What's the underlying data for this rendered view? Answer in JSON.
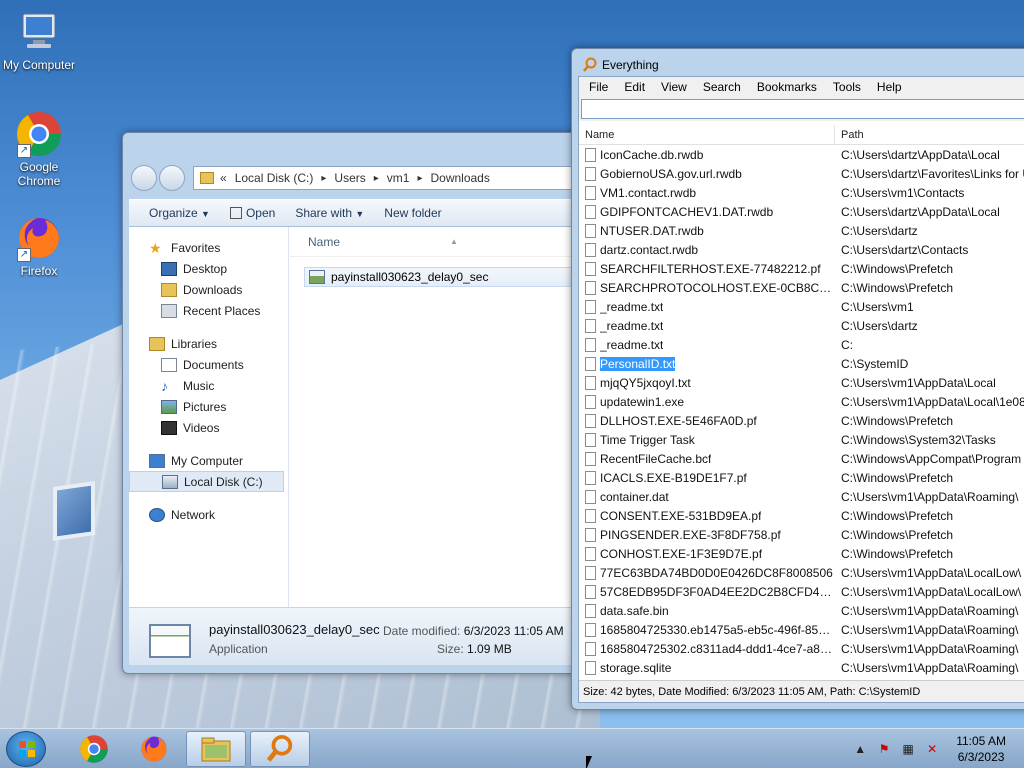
{
  "desktop": {
    "icons": [
      {
        "label": "My Computer"
      },
      {
        "label": "Google Chrome"
      },
      {
        "label": "Firefox"
      }
    ]
  },
  "explorer": {
    "breadcrumb": {
      "prefix": "«",
      "parts": [
        "Local Disk (C:)",
        "Users",
        "vm1",
        "Downloads"
      ]
    },
    "toolbar": {
      "organize": "Organize",
      "open": "Open",
      "share_with": "Share with",
      "new_folder": "New folder"
    },
    "nav": {
      "favorites": "Favorites",
      "desktop": "Desktop",
      "downloads": "Downloads",
      "recent_places": "Recent Places",
      "libraries": "Libraries",
      "documents": "Documents",
      "music": "Music",
      "pictures": "Pictures",
      "videos": "Videos",
      "my_computer": "My Computer",
      "local_disk": "Local Disk (C:)",
      "network": "Network"
    },
    "column_name": "Name",
    "file": "payinstall030623_delay0_sec",
    "details": {
      "name": "payinstall030623_delay0_sec",
      "type": "Application",
      "date_label": "Date modified:",
      "date_value": "6/3/2023 11:05 AM",
      "size_label": "Size:",
      "size_value": "1.09 MB"
    }
  },
  "everything": {
    "title": "Everything",
    "menu": [
      "File",
      "Edit",
      "View",
      "Search",
      "Bookmarks",
      "Tools",
      "Help"
    ],
    "search_value": "",
    "columns": {
      "name": "Name",
      "path": "Path"
    },
    "rows": [
      {
        "name": "IconCache.db.rwdb",
        "path": "C:\\Users\\dartz\\AppData\\Local"
      },
      {
        "name": "GobiernoUSA.gov.url.rwdb",
        "path": "C:\\Users\\dartz\\Favorites\\Links for U"
      },
      {
        "name": "VM1.contact.rwdb",
        "path": "C:\\Users\\vm1\\Contacts"
      },
      {
        "name": "GDIPFONTCACHEV1.DAT.rwdb",
        "path": "C:\\Users\\dartz\\AppData\\Local"
      },
      {
        "name": "NTUSER.DAT.rwdb",
        "path": "C:\\Users\\dartz"
      },
      {
        "name": "dartz.contact.rwdb",
        "path": "C:\\Users\\dartz\\Contacts"
      },
      {
        "name": "SEARCHFILTERHOST.EXE-77482212.pf",
        "path": "C:\\Windows\\Prefetch"
      },
      {
        "name": "SEARCHPROTOCOLHOST.EXE-0CB8CADE...",
        "path": "C:\\Windows\\Prefetch"
      },
      {
        "name": "_readme.txt",
        "path": "C:\\Users\\vm1"
      },
      {
        "name": "_readme.txt",
        "path": "C:\\Users\\dartz"
      },
      {
        "name": "_readme.txt",
        "path": "C:"
      },
      {
        "name": "PersonalID.txt",
        "path": "C:\\SystemID",
        "selected": true
      },
      {
        "name": "mjqQY5jxqoyI.txt",
        "path": "C:\\Users\\vm1\\AppData\\Local"
      },
      {
        "name": "updatewin1.exe",
        "path": "C:\\Users\\vm1\\AppData\\Local\\1e08"
      },
      {
        "name": "DLLHOST.EXE-5E46FA0D.pf",
        "path": "C:\\Windows\\Prefetch"
      },
      {
        "name": "Time Trigger Task",
        "path": "C:\\Windows\\System32\\Tasks"
      },
      {
        "name": "RecentFileCache.bcf",
        "path": "C:\\Windows\\AppCompat\\Program"
      },
      {
        "name": "ICACLS.EXE-B19DE1F7.pf",
        "path": "C:\\Windows\\Prefetch"
      },
      {
        "name": "container.dat",
        "path": "C:\\Users\\vm1\\AppData\\Roaming\\"
      },
      {
        "name": "CONSENT.EXE-531BD9EA.pf",
        "path": "C:\\Windows\\Prefetch"
      },
      {
        "name": "PINGSENDER.EXE-3F8DF758.pf",
        "path": "C:\\Windows\\Prefetch"
      },
      {
        "name": "CONHOST.EXE-1F3E9D7E.pf",
        "path": "C:\\Windows\\Prefetch"
      },
      {
        "name": "77EC63BDA74BD0D0E0426DC8F8008506",
        "path": "C:\\Users\\vm1\\AppData\\LocalLow\\"
      },
      {
        "name": "57C8EDB95DF3F0AD4EE2DC2B8CFD4157",
        "path": "C:\\Users\\vm1\\AppData\\LocalLow\\"
      },
      {
        "name": "data.safe.bin",
        "path": "C:\\Users\\vm1\\AppData\\Roaming\\"
      },
      {
        "name": "1685804725330.eb1475a5-eb5c-496f-8529-...",
        "path": "C:\\Users\\vm1\\AppData\\Roaming\\"
      },
      {
        "name": "1685804725302.c8311ad4-ddd1-4ce7-a8b5...",
        "path": "C:\\Users\\vm1\\AppData\\Roaming\\"
      },
      {
        "name": "storage.sqlite",
        "path": "C:\\Users\\vm1\\AppData\\Roaming\\"
      }
    ],
    "status": "Size: 42 bytes, Date Modified: 6/3/2023 11:05 AM, Path: C:\\SystemID"
  },
  "taskbar": {
    "clock_time": "11:05 AM",
    "clock_date": "6/3/2023"
  }
}
